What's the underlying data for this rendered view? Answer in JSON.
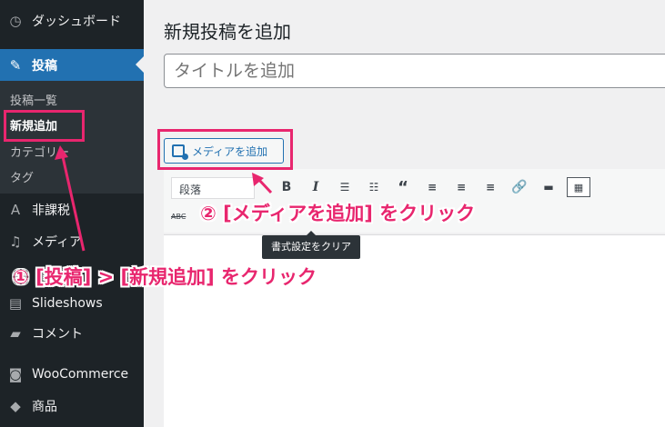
{
  "sidebar": {
    "items": [
      {
        "label": "ダッシュボード",
        "icon": "dashboard-icon"
      },
      {
        "label": "投稿",
        "icon": "pin-icon"
      },
      {
        "label": "非課税",
        "icon": "a-badge-icon"
      },
      {
        "label": "メディア",
        "icon": "media-icon"
      },
      {
        "label": "Slideshows",
        "icon": "slideshow-icon"
      },
      {
        "label": "コメント",
        "icon": "comment-icon"
      },
      {
        "label": "WooCommerce",
        "icon": "woocommerce-icon"
      },
      {
        "label": "商品",
        "icon": "box-icon"
      }
    ],
    "submenu": [
      "投稿一覧",
      "新規追加",
      "カテゴリー",
      "タグ"
    ]
  },
  "main": {
    "page_title": "新規投稿を追加",
    "title_placeholder": "タイトルを追加",
    "media_button": "メディアを追加",
    "format_select": "段落",
    "tooltip": "書式設定をクリア"
  },
  "annotations": {
    "step1": "① [投稿] > [新規追加] をクリック",
    "step2": "② [メディアを追加] をクリック",
    "color": "#e8266e"
  },
  "colors": {
    "sidebar_bg": "#1d2327",
    "active_bg": "#2271b1",
    "submenu_bg": "#2c3338"
  }
}
